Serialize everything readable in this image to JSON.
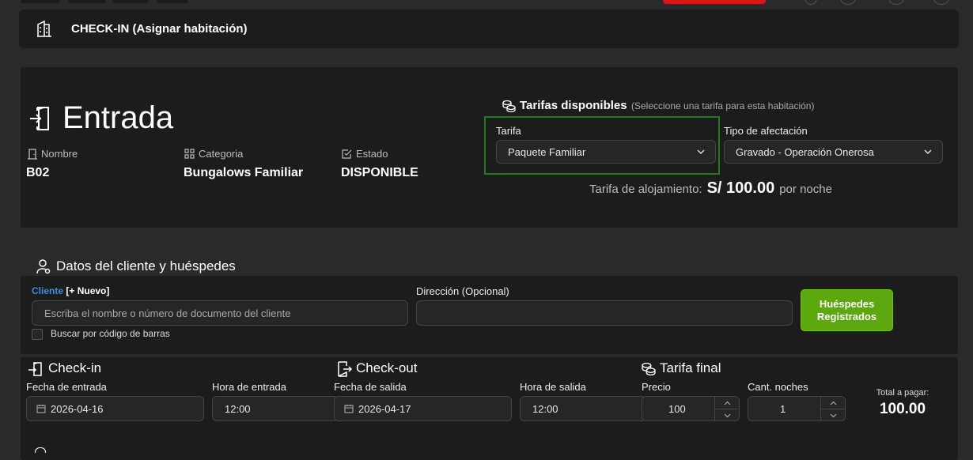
{
  "header": {
    "title": "CHECK-IN (Asignar habitación)"
  },
  "room": {
    "heading": "Entrada",
    "fields": [
      {
        "label": "Nombre",
        "value": "B02"
      },
      {
        "label": "Categoria",
        "value": "Bungalows Familiar"
      },
      {
        "label": "Estado",
        "value": "DISPONIBLE"
      }
    ]
  },
  "tarifas": {
    "title": "Tarifas disponibles",
    "subtitle": "(Seleccione una tarifa para esta habitación)",
    "tarifa_label": "Tarifa",
    "tarifa_value": "Paquete Familiar",
    "afectacion_label": "Tipo de afectación",
    "afectacion_value": "Gravado - Operación Onerosa",
    "alojamiento_label": "Tarifa de alojamiento:",
    "alojamiento_amount": "S/ 100.00",
    "alojamiento_suffix": "por noche"
  },
  "cliente": {
    "section_title": "Datos del cliente y huéspedes",
    "cliente_label": "Cliente",
    "nuevo_label": "[+ Nuevo]",
    "cliente_placeholder": "Escriba el nombre o número de documento del cliente",
    "direccion_label": "Dirección (Opcional)",
    "direccion_value": "",
    "barcode_label": "Buscar por código de barras",
    "huespedes_button": "Huéspedes Registrados"
  },
  "checkin": {
    "title": "Check-in",
    "fecha_label": "Fecha de entrada",
    "fecha_value": "2026-04-16",
    "hora_label": "Hora de entrada",
    "hora_value": "12:00"
  },
  "checkout": {
    "title": "Check-out",
    "fecha_label": "Fecha de salida",
    "fecha_value": "2026-04-17",
    "hora_label": "Hora de salida",
    "hora_value": "12:00"
  },
  "tarifa_final": {
    "title": "Tarifa final",
    "precio_label": "Precio",
    "precio_value": "100",
    "noches_label": "Cant. noches",
    "noches_value": "1",
    "total_label": "Total a pagar:",
    "total_value": "100.00"
  },
  "colors": {
    "accent_green": "#5da80f",
    "link_blue": "#3a8fd6",
    "brand_red": "#d9141a"
  }
}
